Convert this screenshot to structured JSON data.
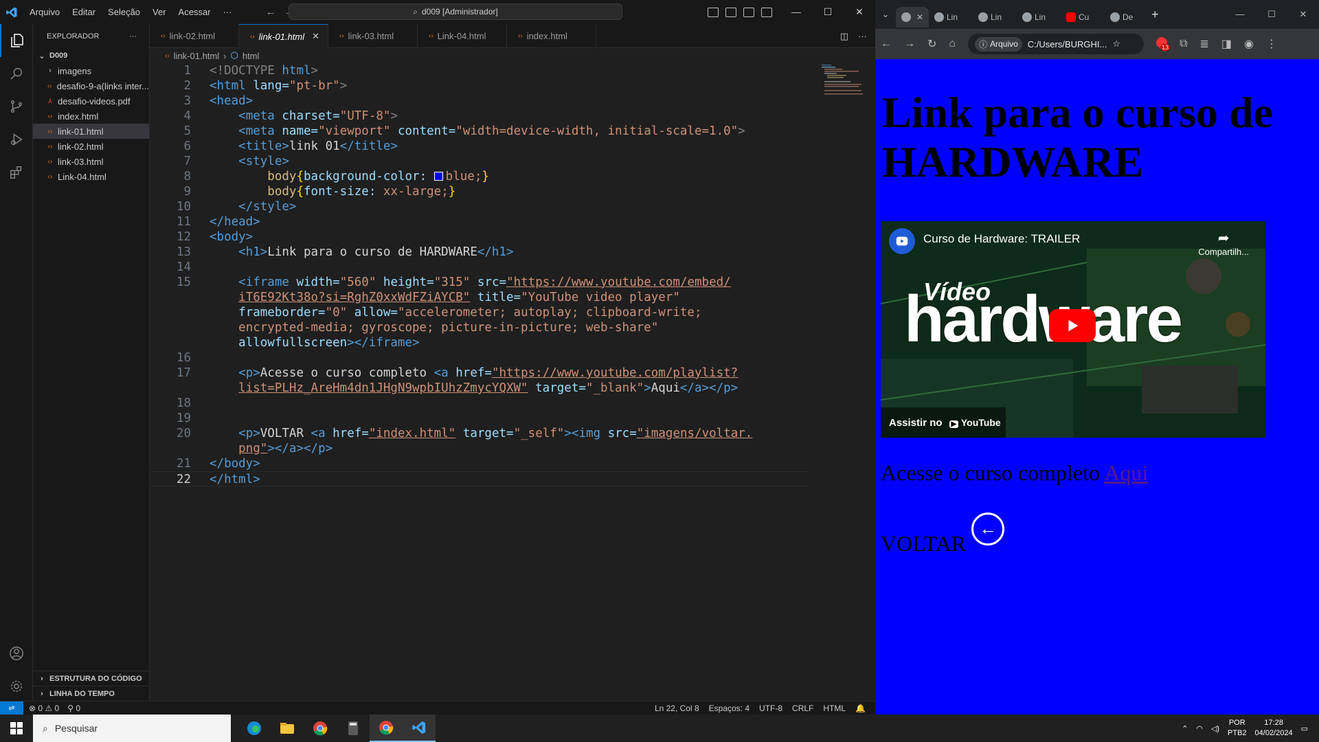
{
  "vscode": {
    "menu": [
      "Arquivo",
      "Editar",
      "Seleção",
      "Ver",
      "Acessar",
      "···"
    ],
    "command_center": "d009 [Administrador]",
    "window_controls": [
      "—",
      "☐",
      "✕"
    ],
    "explorer_title": "EXPLORADOR",
    "explorer_more": "···",
    "folder": "D009",
    "tree": [
      {
        "label": "imagens",
        "type": "folder"
      },
      {
        "label": "desafio-9-a(links inter...",
        "type": "html"
      },
      {
        "label": "desafio-videos.pdf",
        "type": "pdf"
      },
      {
        "label": "index.html",
        "type": "html"
      },
      {
        "label": "link-01.html",
        "type": "html",
        "active": true
      },
      {
        "label": "link-02.html",
        "type": "html"
      },
      {
        "label": "link-03.html",
        "type": "html"
      },
      {
        "label": "Link-04.html",
        "type": "html"
      }
    ],
    "outline_label": "ESTRUTURA DO CÓDIGO",
    "timeline_label": "LINHA DO TEMPO",
    "tabs": [
      {
        "label": "link-02.html",
        "active": false
      },
      {
        "label": "link-01.html",
        "active": true
      },
      {
        "label": "link-03.html",
        "active": false
      },
      {
        "label": "Link-04.html",
        "active": false
      },
      {
        "label": "index.html",
        "active": false
      }
    ],
    "breadcrumb": {
      "file": "link-01.html",
      "node": "html"
    },
    "status": {
      "errors": "0",
      "warnings": "0",
      "ports": "0",
      "position": "Ln 22, Col 8",
      "spaces": "Espaços: 4",
      "encoding": "UTF-8",
      "eol": "CRLF",
      "language": "HTML"
    },
    "line_numbers": [
      "1",
      "2",
      "3",
      "4",
      "5",
      "6",
      "7",
      "8",
      "9",
      "10",
      "11",
      "12",
      "13",
      "14",
      "15",
      "",
      "",
      "",
      "",
      "16",
      "17",
      "",
      "18",
      "19",
      "20",
      "",
      "21",
      "22"
    ],
    "code": {
      "doctype": "<!DOCTYPE",
      "doctype_name": "html",
      "html_open": "<html",
      "lang_attr": "lang=",
      "lang_val": "\"pt-br\"",
      "head_open": "<head>",
      "meta": "<meta",
      "charset_attr": "charset=",
      "charset_val": "\"UTF-8\"",
      "name_attr": "name=",
      "name_val": "\"viewport\"",
      "content_attr": "content=",
      "content_val": "\"width=device-width, initial-scale=1.0\"",
      "title_open": "<title>",
      "title_text": "link 01",
      "title_close": "</title>",
      "style_open": "<style>",
      "css_line1_sel": "body",
      "css_line1_prop": "background-color:",
      "css_line1_val": "blue;",
      "css_line2_sel": "body",
      "css_line2_prop": "font-size:",
      "css_line2_val": "xx-large;",
      "style_close": "</style>",
      "head_close": "</head>",
      "body_open": "<body>",
      "h1_open": "<h1>",
      "h1_text": "Link para o curso de HARDWARE",
      "h1_close": "</h1>",
      "iframe_open": "<iframe",
      "width_attr": "width=",
      "width_val": "\"560\"",
      "height_attr": "height=",
      "height_val": "\"315\"",
      "src_attr": "src=",
      "src_val_1": "\"https://www.youtube.com/embed/",
      "src_val_2": "iT6E92Kt38o?si=RghZ0xxWdFZiAYCB\"",
      "title_attr": "title=",
      "title_val": "\"YouTube video player\"",
      "frameborder_attr": "frameborder=",
      "frameborder_val": "\"0\"",
      "allow_attr": "allow=",
      "allow_val_1": "\"accelerometer; autoplay; clipboard-write;",
      "allow_val_2": "encrypted-media; gyroscope; picture-in-picture; web-share\"",
      "allowfullscreen": "allowfullscreen",
      "iframe_close": "></iframe>",
      "p_open": "<p>",
      "p17_text": "Acesse o curso completo ",
      "a_open": "<a",
      "href_attr": "href=",
      "href17_val_1": "\"https://www.youtube.com/playlist?",
      "href17_val_2": "list=PLHz_AreHm4dn1JHgN9wpbIUhzZmycYQXW\"",
      "target_attr": "target=",
      "target17_val": "\"_blank\"",
      "a17_text": "Aqui",
      "a_close": "</a>",
      "p_close": "</p>",
      "p20_text": "VOLTAR ",
      "href20_val": "\"index.html\"",
      "target20_val": "\"_self\"",
      "img_open": "<img",
      "img_src_val_1": "\"imagens/voltar.",
      "img_src_val_2": "png\"",
      "body_close": "</body>",
      "html_close": "</html>"
    }
  },
  "browser": {
    "tabs": [
      {
        "label": "",
        "active": true
      },
      {
        "label": "Lin"
      },
      {
        "label": "Lin"
      },
      {
        "label": "Lin"
      },
      {
        "label": "Cu",
        "youtube": true
      },
      {
        "label": "De"
      }
    ],
    "address_chip": "Arquivo",
    "address": "C:/Users/BURGHI...",
    "extension_badge": "13",
    "page": {
      "h1": "Link para o curso de HARDWARE",
      "video_title": "Curso de Hardware: TRAILER",
      "video_share": "Compartilh...",
      "video_brand_small": "Vídeo",
      "video_brand_big": "hardware",
      "video_watch_on": "Assistir no",
      "video_youtube": "YouTube",
      "p1_text": "Acesse o curso completo ",
      "p1_link": "Aqui",
      "p2_text": "VOLTAR"
    }
  },
  "taskbar": {
    "search_placeholder": "Pesquisar",
    "language": "POR",
    "layout": "PTB2",
    "time": "17:28",
    "date": "04/02/2024"
  },
  "colors": {
    "accent": "#0078d4",
    "page_bg": "#0000ff",
    "html_icon": "#e37933"
  }
}
